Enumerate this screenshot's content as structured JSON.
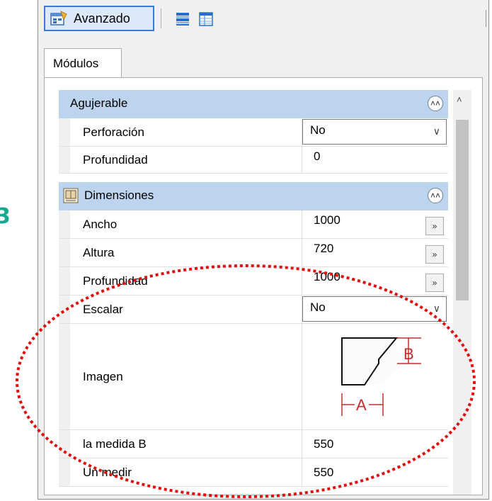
{
  "toolbar": {
    "advanced_label": "Avanzado"
  },
  "tabs": [
    {
      "label": "Módulos"
    }
  ],
  "categories": [
    {
      "label": "Agujerable",
      "rows": [
        {
          "name": "Perforación",
          "value": "No",
          "type": "dropdown"
        },
        {
          "name": "Profundidad",
          "value": "0",
          "type": "text"
        }
      ]
    },
    {
      "label": "Dimensiones",
      "rows": [
        {
          "name": "Ancho",
          "value": "1000",
          "type": "ellipsis"
        },
        {
          "name": "Altura",
          "value": "720",
          "type": "ellipsis"
        },
        {
          "name": "Profundidad",
          "value": "1000",
          "type": "ellipsis"
        },
        {
          "name": "Escalar",
          "value": "No",
          "type": "dropdown"
        },
        {
          "name": "Imagen",
          "type": "image",
          "diagram_labels": {
            "a": "A",
            "b": "B"
          }
        },
        {
          "name": "la medida B",
          "value": "550",
          "type": "text"
        },
        {
          "name": "Un medir",
          "value": "550",
          "type": "text"
        }
      ]
    }
  ],
  "icons": {
    "collapse": "double-chevron-up-icon",
    "ellipsis": "double-chevron-right-icon"
  },
  "colors": {
    "category_bg": "#bcd4ee",
    "toolbar_active_border": "#3a7ad6",
    "annotation": "#e01010",
    "side_mark": "#17a88f"
  }
}
